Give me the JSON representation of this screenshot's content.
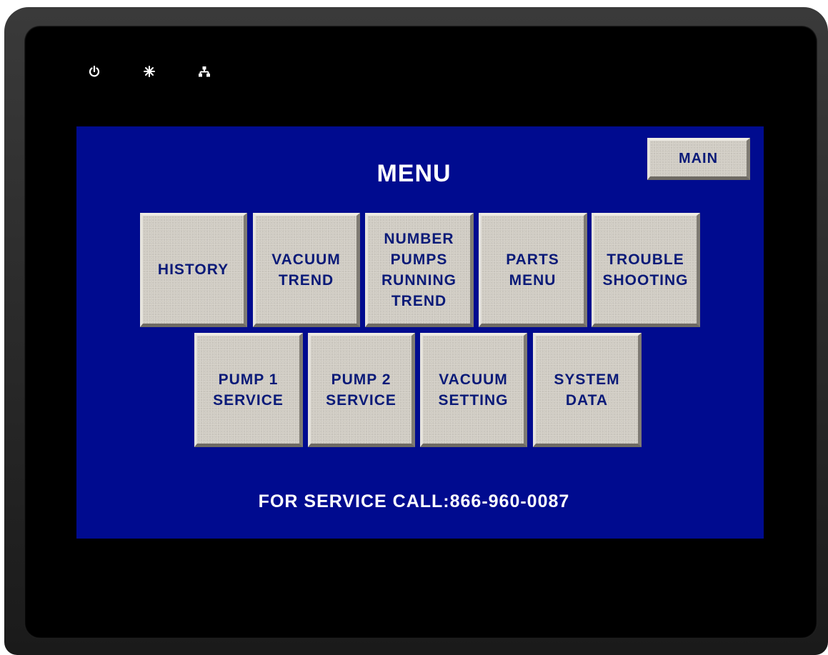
{
  "panel": {
    "indicators": [
      {
        "icon": "power-icon"
      },
      {
        "icon": "brightness-icon"
      },
      {
        "icon": "network-icon"
      }
    ]
  },
  "screen": {
    "background_color": "#000b8f",
    "title": "MENU",
    "main_button": "MAIN",
    "menu_row1": [
      {
        "label": "HISTORY"
      },
      {
        "label": "VACUUM\nTREND"
      },
      {
        "label": "NUMBER\nPUMPS\nRUNNING\nTREND"
      },
      {
        "label": "PARTS\nMENU"
      },
      {
        "label": "TROUBLE\nSHOOTING"
      }
    ],
    "menu_row2": [
      {
        "label": "PUMP 1\nSERVICE"
      },
      {
        "label": "PUMP 2\nSERVICE"
      },
      {
        "label": "VACUUM\nSETTING"
      },
      {
        "label": "SYSTEM\nDATA"
      }
    ],
    "footer": "FOR SERVICE CALL:866-960-0087"
  }
}
